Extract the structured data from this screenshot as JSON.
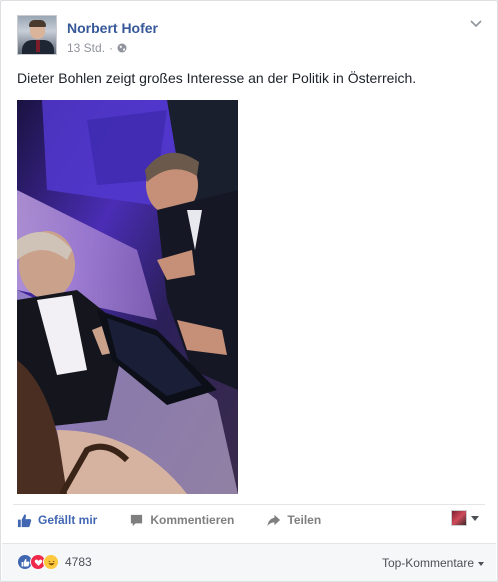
{
  "post": {
    "author": "Norbert Hofer",
    "time": "13 Std.",
    "separator": "·",
    "text": "Dieter Bohlen zeigt großes Interesse an der Politik in Österreich."
  },
  "actions": {
    "like_label": "Gefällt mir",
    "comment_label": "Kommentieren",
    "share_label": "Teilen"
  },
  "reactions": {
    "count": "4783",
    "types": [
      "like",
      "love",
      "haha"
    ]
  },
  "comments": {
    "sort_label": "Top-Kommentare"
  },
  "colors": {
    "link_blue": "#365899",
    "like_blue": "#4267b2",
    "love_red": "#f0284a",
    "haha_yellow": "#fcc93e"
  },
  "icons": [
    "globe-icon",
    "chevron-down-icon",
    "like-icon",
    "comment-icon",
    "share-icon",
    "like-reaction-icon",
    "love-reaction-icon",
    "haha-reaction-icon"
  ]
}
